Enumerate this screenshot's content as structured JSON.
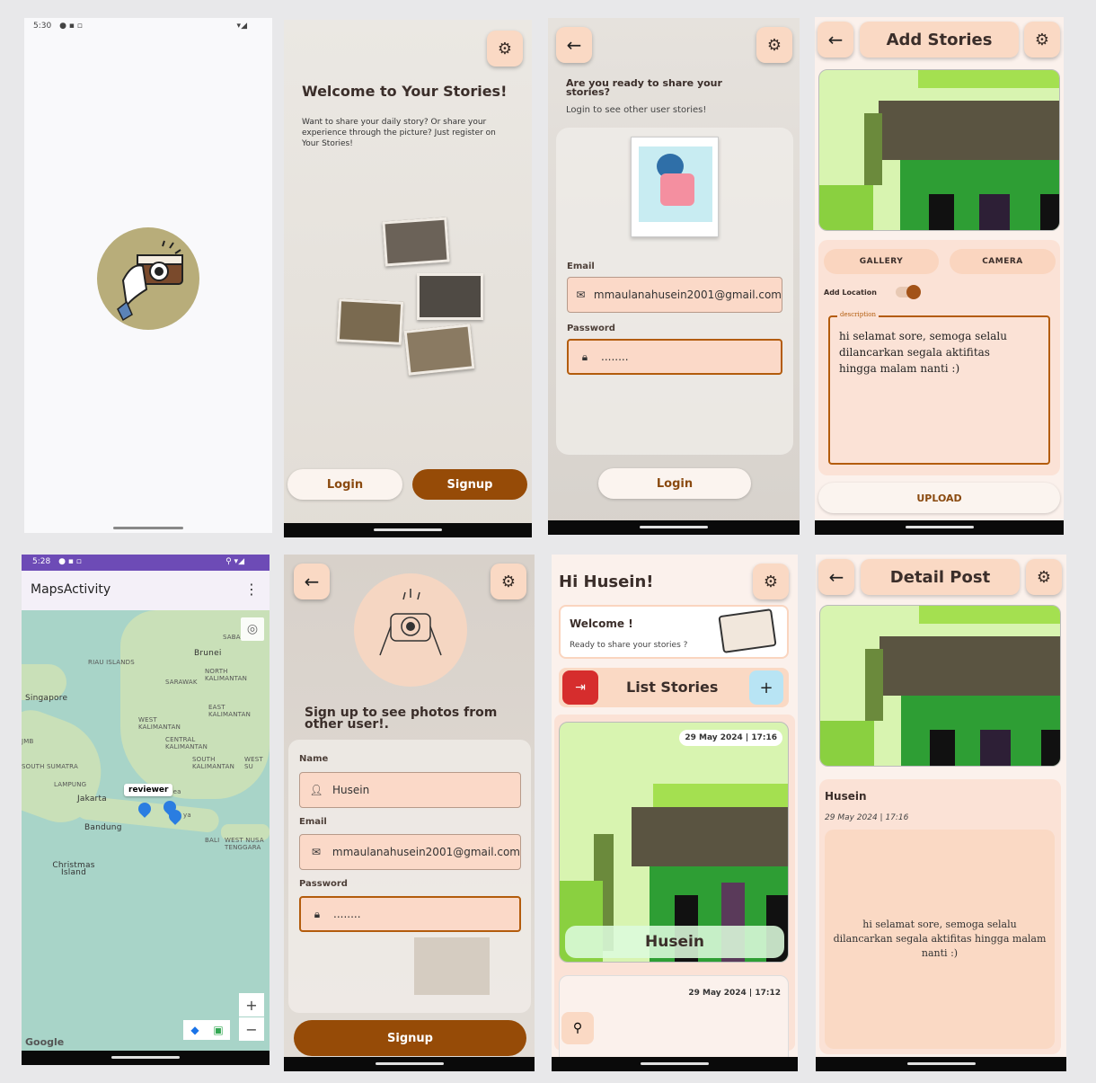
{
  "splash": {
    "status_time": "5:30"
  },
  "welcome": {
    "title": "Welcome to Your Stories!",
    "body": "Want to share your daily story? Or share your experience through the picture? Just register on Your Stories!",
    "login_label": "Login",
    "signup_label": "Signup"
  },
  "login": {
    "title": "Are you ready to share your stories?",
    "subtitle": "Login to see other user stories!",
    "email_label": "Email",
    "email_value": "mmaulanahusein2001@gmail.com",
    "password_label": "Password",
    "password_value": "........",
    "login_label": "Login"
  },
  "add_story": {
    "header": "Add Stories",
    "gallery_label": "GALLERY",
    "camera_label": "CAMERA",
    "location_label": "Add Location",
    "description_label": "description",
    "description_value": "hi selamat sore, semoga selalu dilancarkan segala aktifitas hingga malam nanti :)",
    "upload_label": "UPLOAD"
  },
  "maps": {
    "status_time": "5:28",
    "app_title": "MapsActivity",
    "marker_label": "reviewer",
    "places": [
      "RIAU ISLANDS",
      "Brunei",
      "SARAWAK",
      "NORTH KALIMANTAN",
      "Singapore",
      "EAST KALIMANTAN",
      "WEST KALIMANTAN",
      "CENTRAL KALIMANTAN",
      "SOUTH KALIMANTAN",
      "SOUTH SUMATRA",
      "LAMPUNG",
      "Jakarta",
      "Bandung",
      "BALI",
      "WEST NUSA TENGGARA",
      "Christmas Island",
      "Sea",
      "ya",
      "SABA",
      "WEST SU",
      "JMB"
    ],
    "zoom_in": "+",
    "zoom_out": "−",
    "google": "Google"
  },
  "signup": {
    "title": "Sign up to see photos from other user!.",
    "name_label": "Name",
    "name_value": "Husein",
    "email_label": "Email",
    "email_value": "mmaulanahusein2001@gmail.com",
    "password_label": "Password",
    "password_value": "........",
    "signup_label": "Signup"
  },
  "list": {
    "greeting": "Hi Husein!",
    "welcome_title": "Welcome !",
    "welcome_sub": "Ready to share your stories ?",
    "list_title": "List Stories",
    "add_label": "+",
    "items": [
      {
        "date": "29 May 2024 | 17:16",
        "name": "Husein"
      },
      {
        "date": "29 May 2024 | 17:12"
      }
    ]
  },
  "detail": {
    "header": "Detail Post",
    "name": "Husein",
    "date": "29 May 2024 | 17:16",
    "description": "hi selamat sore, semoga selalu dilancarkan segala aktifitas hingga malam nanti :)"
  }
}
